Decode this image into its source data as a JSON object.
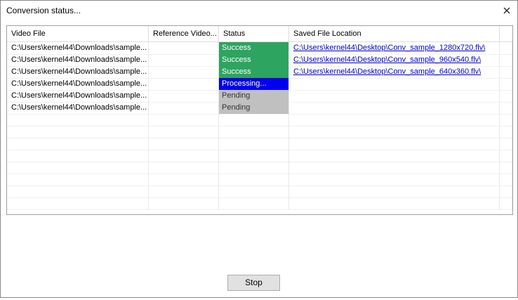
{
  "window": {
    "title": "Conversion status..."
  },
  "table": {
    "headers": [
      "Video File",
      "Reference Video...",
      "Status",
      "Saved File Location"
    ],
    "rows": [
      {
        "video": "C:\\Users\\kernel44\\Downloads\\sample...",
        "reference": "",
        "status": "Success",
        "status_color": "#2da460",
        "location": "C:\\Users\\kernel44\\Desktop\\Conv_sample_1280x720.flv\\"
      },
      {
        "video": "C:\\Users\\kernel44\\Downloads\\sample...",
        "reference": "",
        "status": "Success",
        "status_color": "#2da460",
        "location": "C:\\Users\\kernel44\\Desktop\\Conv_sample_960x540.flv\\"
      },
      {
        "video": "C:\\Users\\kernel44\\Downloads\\sample...",
        "reference": "",
        "status": "Success",
        "status_color": "#2da460",
        "location": "C:\\Users\\kernel44\\Desktop\\Conv_sample_640x360.flv\\"
      },
      {
        "video": "C:\\Users\\kernel44\\Downloads\\sample...",
        "reference": "",
        "status": "Processing...",
        "status_color": "#0000ee",
        "location": ""
      },
      {
        "video": "C:\\Users\\kernel44\\Downloads\\sample...",
        "reference": "",
        "status": "Pending",
        "status_color": "#c0c0c0",
        "location": ""
      },
      {
        "video": "C:\\Users\\kernel44\\Downloads\\sample...",
        "reference": "",
        "status": "Pending",
        "status_color": "#c0c0c0",
        "location": ""
      }
    ]
  },
  "buttons": {
    "stop": "Stop"
  },
  "colors": {
    "pending_text": "#333333",
    "link": "#0000cc"
  }
}
